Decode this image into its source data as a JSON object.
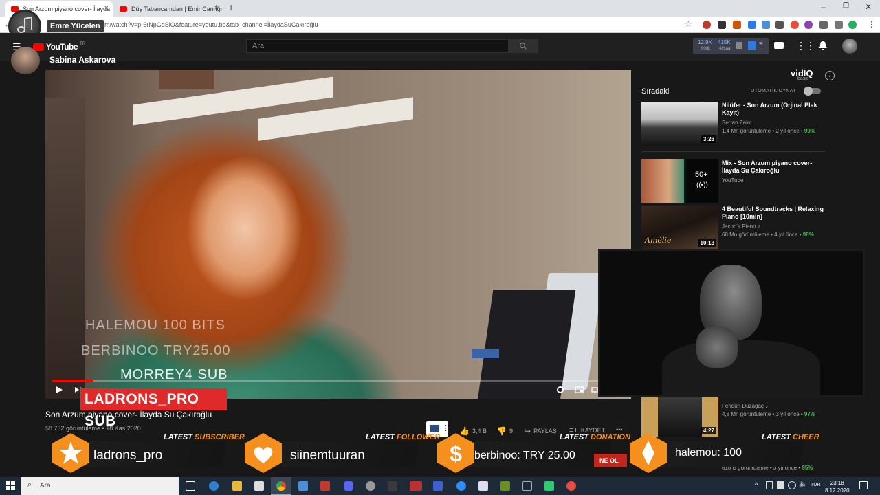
{
  "browser": {
    "tabs": [
      {
        "label": "Son Arzum piyano cover- İlayda"
      },
      {
        "label": "Düş Tabancamdan | Emir Can İğr"
      }
    ],
    "new_tab": "+",
    "url": ".com/watch?v=p-6rNpGdSlQ&feature=youtu.be&tab_channel=İlaydaSuÇakıroğlu",
    "tooltip": "Emre Yücelen"
  },
  "youtube": {
    "logo": "YouTube",
    "logo_tr": "TR",
    "channel_overlay": "Sabina Askarova",
    "search_placeholder": "Ara",
    "vidiq": {
      "views": "12.9K",
      "views_sub": "60dk",
      "views2": "415K",
      "views2_sub": "48saat"
    },
    "video": {
      "title": "Son Arzum piyano cover- İlayda Su Çakıroğlu",
      "views": "58.732 görüntüleme • 18 Kas 2020",
      "likes": "3,4 B",
      "dislikes": "9",
      "share": "PAYLAŞ",
      "save": "KAYDET",
      "more": "•••"
    },
    "overlay_texts": {
      "line1": "HALEMOU  100 BITS",
      "line2": "BERBINOO  TRY25.00",
      "line3": "MORREY4  SUB",
      "line4": "LADRONS_PRO  SUB"
    },
    "sidebar": {
      "vidiq_logo": "vidIQ",
      "vidiq_tier": "basic",
      "up_next": "Sıradaki",
      "autoplay": "OTOMATİK OYNAT",
      "recs": [
        {
          "title": "Nilüfer - Son Arzum (Orjinal Plak Kayıt)",
          "channel": "Sertan Zaim",
          "meta": "1,4 Mn görüntüleme • 2 yıl önce •",
          "score": "99%",
          "duration": "3:26"
        },
        {
          "title": "Mix - Son Arzum piyano cover- İlayda Su Çakıroğlu",
          "channel": "YouTube",
          "meta": "",
          "score": "",
          "duration": "50+"
        },
        {
          "title": "4 Beautiful Soundtracks | Relaxing Piano [10min]",
          "channel": "Jacob's Piano ♪",
          "meta": "68 Mn görüntüleme • 4 yıl önce •",
          "score": "98%",
          "duration": "10:13",
          "thumb_text": "Amélie"
        },
        {
          "title": "",
          "channel": "Feridun Düzağaç ♪",
          "meta": "4,8 Mn görüntüleme • 3 yıl önce •",
          "score": "97%",
          "duration": "4:27"
        },
        {
          "title": "",
          "channel": "",
          "meta": "818 B görüntüleme • 3 yıl önce •",
          "score": "95%",
          "duration": ""
        }
      ]
    },
    "join_partial": "NE OL"
  },
  "alerts": [
    {
      "kind_prefix": "LATEST",
      "kind": "SUBSCRIBER",
      "name": "ladrons_pro",
      "icon": "star-icon"
    },
    {
      "kind_prefix": "LATEST",
      "kind": "FOLLOWER",
      "name": "siinemtuuran",
      "icon": "heart-icon"
    },
    {
      "kind_prefix": "LATEST",
      "kind": "DONATION",
      "name": "berbinoo: TRY 25.00",
      "icon": "dollar-icon"
    },
    {
      "kind_prefix": "LATEST",
      "kind": "CHEER",
      "name": "halemou: 100",
      "icon": "diamond-icon"
    }
  ],
  "taskbar": {
    "search": "Ara",
    "lang": "TUR",
    "time": "23:18",
    "date": "8.12.2020"
  },
  "colors": {
    "accent_orange": "#f5901e",
    "yt_red": "#ff0000",
    "vidiq_green": "#2ecc40"
  }
}
